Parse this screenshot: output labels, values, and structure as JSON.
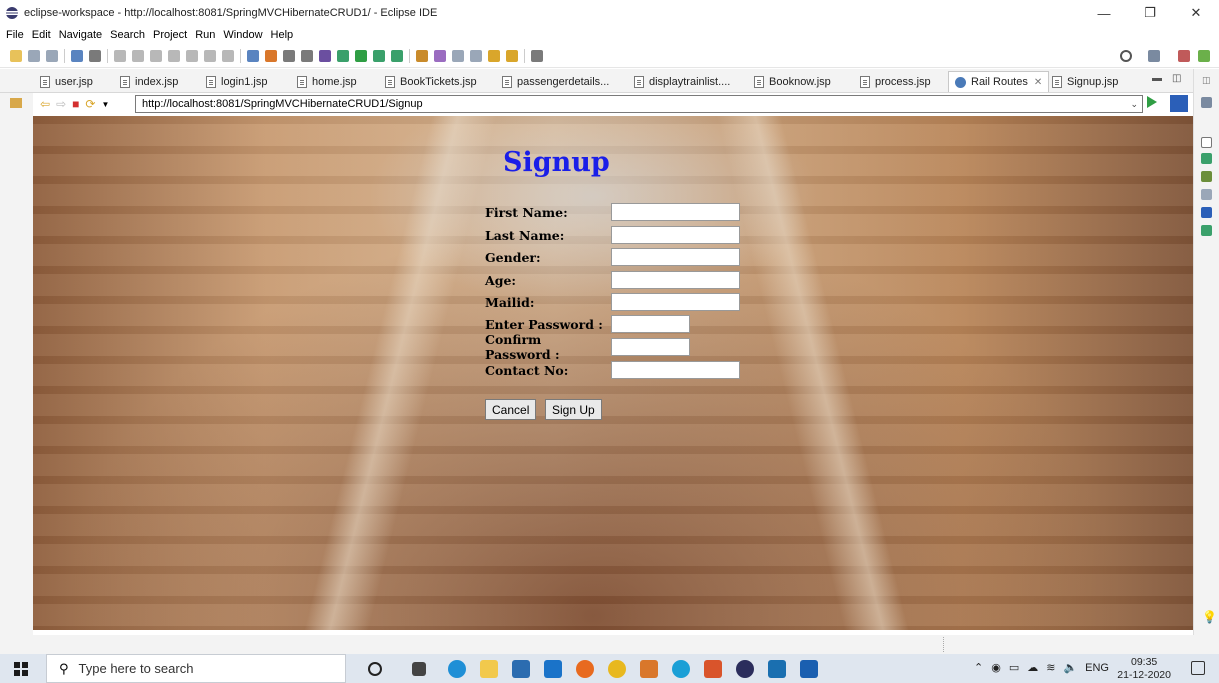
{
  "window": {
    "title": "eclipse-workspace - http://localhost:8081/SpringMVCHibernateCRUD1/ - Eclipse IDE"
  },
  "menu": [
    "File",
    "Edit",
    "Navigate",
    "Search",
    "Project",
    "Run",
    "Window",
    "Help"
  ],
  "tabs": [
    {
      "label": "user.jsp"
    },
    {
      "label": "index.jsp"
    },
    {
      "label": "login1.jsp"
    },
    {
      "label": "home.jsp"
    },
    {
      "label": "BookTickets.jsp"
    },
    {
      "label": "passengerdetails..."
    },
    {
      "label": "displaytrainlist...."
    },
    {
      "label": "Booknow.jsp"
    },
    {
      "label": "process.jsp"
    },
    {
      "label": "Rail Routes",
      "active": true,
      "close": "✕"
    },
    {
      "label": "Signup.jsp"
    }
  ],
  "browser": {
    "url": "http://localhost:8081/SpringMVCHibernateCRUD1/Signup"
  },
  "form": {
    "title": "Signup",
    "fields": [
      {
        "label": "First Name:",
        "value": ""
      },
      {
        "label": "Last Name:",
        "value": ""
      },
      {
        "label": "Gender:",
        "value": ""
      },
      {
        "label": "Age:",
        "value": ""
      },
      {
        "label": "Mailid:",
        "value": ""
      },
      {
        "label": "Enter Password :",
        "value": ""
      },
      {
        "label": "Confirm Password :",
        "value": ""
      },
      {
        "label": "Contact No:",
        "value": ""
      }
    ],
    "cancel_label": "Cancel",
    "signup_label": "Sign Up"
  },
  "taskbar": {
    "search_placeholder": "Type here to search",
    "language": "ENG",
    "time": "09:35",
    "date": "21-12-2020"
  }
}
